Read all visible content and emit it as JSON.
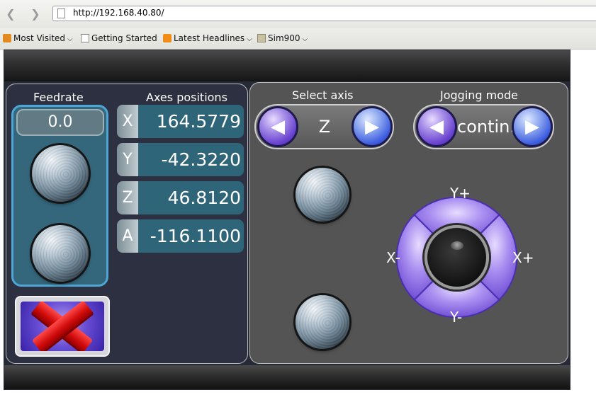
{
  "browser": {
    "url": "http://192.168.40.80/",
    "bookmarks": [
      "Most Visited",
      "Getting Started",
      "Latest Headlines",
      "Sim900"
    ]
  },
  "feedrate": {
    "label": "Feedrate",
    "value": "0.0"
  },
  "axes": {
    "label": "Axes positions",
    "rows": [
      {
        "axis": "X",
        "value": "164.5779"
      },
      {
        "axis": "Y",
        "value": "-42.3220"
      },
      {
        "axis": "Z",
        "value": "46.8120"
      },
      {
        "axis": "A",
        "value": "-116.1100"
      }
    ]
  },
  "select_axis": {
    "label": "Select axis",
    "value": "Z"
  },
  "jogging_mode": {
    "label": "Jogging mode",
    "value": "contin."
  },
  "jog": {
    "y_plus": "Y+",
    "y_minus": "Y-",
    "x_plus": "X+",
    "x_minus": "X-"
  },
  "colors": {
    "jog_purple": "#8f73e6",
    "axis_value_bg": "#2f6579",
    "feed_border": "#4ea6d6",
    "stop_red": "#e01010"
  }
}
